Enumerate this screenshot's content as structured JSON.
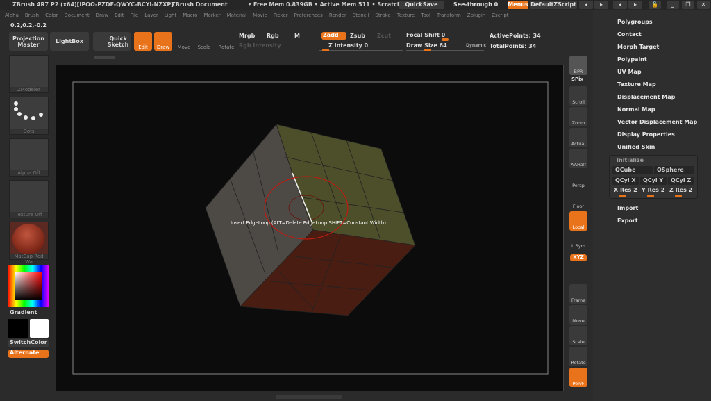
{
  "titlebar": {
    "app": "ZBrush 4R7 P2 (x64)[IPOO-PZDF-QWYC-BCYI-NZXP]",
    "doc": "ZBrush Document",
    "mem": "• Free Mem 0.839GB • Active Mem 511 • Scratch",
    "quicksave": "QuickSave",
    "seethrough": "See-through  0",
    "menus": "Menus",
    "script": "DefaultZScript"
  },
  "menubar": [
    "Alpha",
    "Brush",
    "Color",
    "Document",
    "Draw",
    "Edit",
    "File",
    "Layer",
    "Light",
    "Macro",
    "Marker",
    "Material",
    "Movie",
    "Picker",
    "Preferences",
    "Render",
    "Stencil",
    "Stroke",
    "Texture",
    "Tool",
    "Transform",
    "Zplugin",
    "Zscript"
  ],
  "coords": "0.2,0.2,-0.2",
  "toolbar": {
    "projection": "Projection Master",
    "lightbox": "LightBox",
    "quicksketch": "Quick Sketch",
    "edit": "Edit",
    "draw": "Draw",
    "move": "Move",
    "scale": "Scale",
    "rotate": "Rotate",
    "mrgb": "Mrgb",
    "rgb": "Rgb",
    "m": "M",
    "zadd": "Zadd",
    "zsub": "Zsub",
    "zcut": "Zcut",
    "rgb_intensity": "Rgb Intensity",
    "z_intensity": "Z Intensity 0",
    "focal_shift": "Focal Shift 0",
    "draw_size": "Draw Size 64",
    "dynamic": "Dynamic",
    "active_points": "ActivePoints: 34",
    "total_points": "TotalPoints: 34"
  },
  "left": {
    "brush": "ZModeler",
    "stroke": "Dots",
    "alpha": "Alpha Off",
    "texture": "Texture Off",
    "material": "MatCap Red Wa",
    "gradient": "Gradient",
    "switchcolor": "SwitchColor",
    "alternate": "Alternate"
  },
  "viewport": {
    "tooltip": "Insert EdgeLoop (ALT=Delete EdgeLoop SHIFT=Constant Width)"
  },
  "righttools": [
    "BPR",
    "SPix",
    "Scroll",
    "Zoom",
    "Actual",
    "AAHalf",
    "Persp",
    "Floor",
    "Local",
    "L.Sym",
    "XYZ",
    "Frame",
    "Move",
    "Scale",
    "Rotate",
    "PolyF"
  ],
  "tool_menu": {
    "items_top": [
      "Polygroups",
      "Contact",
      "Morph Target",
      "Polypaint",
      "UV Map",
      "Texture Map",
      "Displacement Map",
      "Normal Map",
      "Vector Displacement Map",
      "Display Properties",
      "Unified Skin"
    ],
    "initialize": "Initialize",
    "qcube": "QCube",
    "qsphere": "QSphere",
    "qcylx": "QCyl X",
    "qcyly": "QCyl Y",
    "qcylz": "QCyl Z",
    "xres": "X Res 2",
    "yres": "Y Res 2",
    "zres": "Z Res 2",
    "items_bottom": [
      "Import",
      "Export"
    ]
  },
  "colors": {
    "accent": "#e9731b",
    "top_face": "#4c4f2a",
    "left_face": "#4d4a45",
    "bottom_face": "#4a1d12"
  }
}
